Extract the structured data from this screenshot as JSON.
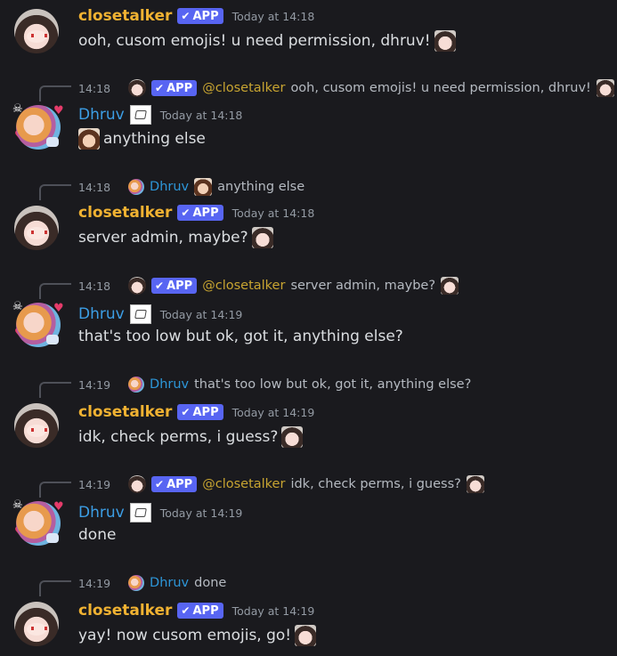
{
  "messages": {
    "m1": {
      "author": "closetalker",
      "badge": "APP",
      "timestamp": "Today at 14:18",
      "text": "ooh, cusom emojis! u need permission, dhruv!"
    },
    "m2": {
      "reply_time": "14:18",
      "reply_badge": "APP",
      "reply_mention": "@closetalker",
      "reply_text": "ooh, cusom emojis! u need permission, dhruv!",
      "author": "Dhruv",
      "timestamp": "Today at 14:18",
      "text": "anything else"
    },
    "m3": {
      "reply_time": "14:18",
      "reply_user": "Dhruv",
      "reply_text": "anything else",
      "author": "closetalker",
      "badge": "APP",
      "timestamp": "Today at 14:18",
      "text": "server admin, maybe?"
    },
    "m4": {
      "reply_time": "14:18",
      "reply_badge": "APP",
      "reply_mention": "@closetalker",
      "reply_text": "server admin, maybe?",
      "author": "Dhruv",
      "timestamp": "Today at 14:19",
      "text": "that's too low but ok, got it, anything else?"
    },
    "m5": {
      "reply_time": "14:19",
      "reply_user": "Dhruv",
      "reply_text": "that's too low but ok, got it, anything else?",
      "author": "closetalker",
      "badge": "APP",
      "timestamp": "Today at 14:19",
      "text": "idk, check perms, i guess?"
    },
    "m6": {
      "reply_time": "14:19",
      "reply_badge": "APP",
      "reply_mention": "@closetalker",
      "reply_text": "idk, check perms, i guess?",
      "author": "Dhruv",
      "timestamp": "Today at 14:19",
      "text": "done"
    },
    "m7": {
      "reply_time": "14:19",
      "reply_user": "Dhruv",
      "reply_text": "done",
      "author": "closetalker",
      "badge": "APP",
      "timestamp": "Today at 14:19",
      "text": "yay! now cusom emojis, go!"
    }
  },
  "colors": {
    "background": "#1a1a1e",
    "closetalker_name": "#f0b232",
    "dhruv_name": "#3c9ee5",
    "app_badge": "#5865f2",
    "mention": "#c7a431"
  },
  "icons": {
    "badge_check": "✔"
  }
}
